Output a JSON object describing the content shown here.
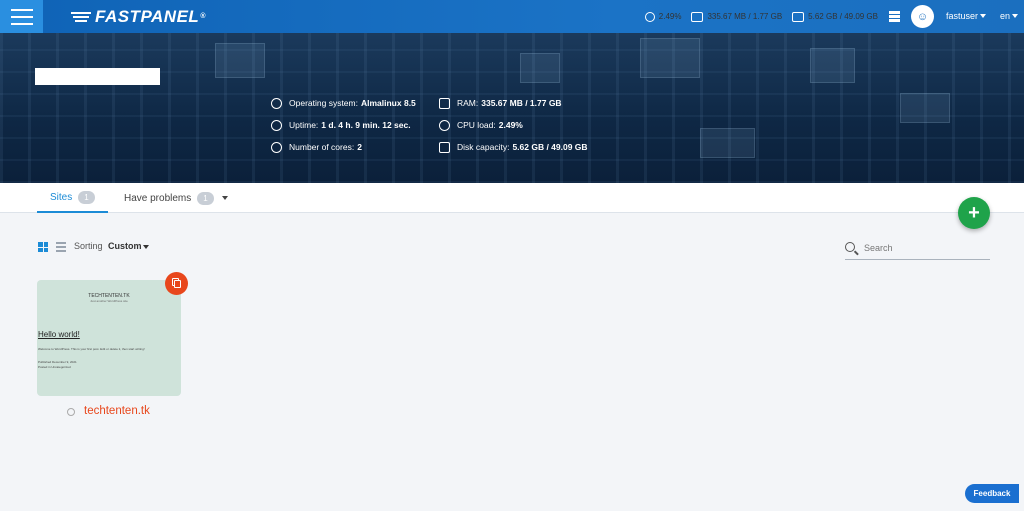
{
  "brand": {
    "name": "FASTPANEL",
    "mark": "®"
  },
  "topbar": {
    "cpu": "2.49%",
    "ram": "335.67 MB / 1.77 GB",
    "disk": "5.62 GB / 49.09 GB",
    "user": "fastuser",
    "language": "en"
  },
  "server_info": {
    "left": [
      {
        "label": "Operating system:",
        "value": "Almalinux 8.5",
        "icon": "os-icon"
      },
      {
        "label": "Uptime:",
        "value": "1 d. 4 h. 9 min. 12 sec.",
        "icon": "uptime-icon"
      },
      {
        "label": "Number of cores:",
        "value": "2",
        "icon": "cores-icon"
      }
    ],
    "right": [
      {
        "label": "RAM:",
        "value": "335.67 MB / 1.77 GB",
        "icon": "ram-icon"
      },
      {
        "label": "CPU load:",
        "value": "2.49%",
        "icon": "cpu-icon"
      },
      {
        "label": "Disk capacity:",
        "value": "5.62 GB / 49.09 GB",
        "icon": "disk-icon"
      }
    ]
  },
  "tabs": [
    {
      "label": "Sites",
      "count": "1",
      "active": true
    },
    {
      "label": "Have problems",
      "count": "1",
      "active": false
    }
  ],
  "toolbar": {
    "sorting_label": "Sorting",
    "sorting_value": "Custom",
    "search_placeholder": "Search"
  },
  "site": {
    "domain": "techtenten.tk",
    "preview": {
      "title": "TECHTENTEN.TK",
      "tagline": "Just another WordPress site",
      "hello": "Hello world!",
      "text": "Welcome to WordPress. This is your first post. Edit or delete it, then start writing!",
      "published": "Published December 9, 2021",
      "category": "Posted in Uncategorized"
    }
  },
  "feedback_label": "Feedback",
  "colors": {
    "accent": "#1b8bd6",
    "brand_orange": "#e8471c",
    "add_green": "#1fa34a"
  }
}
